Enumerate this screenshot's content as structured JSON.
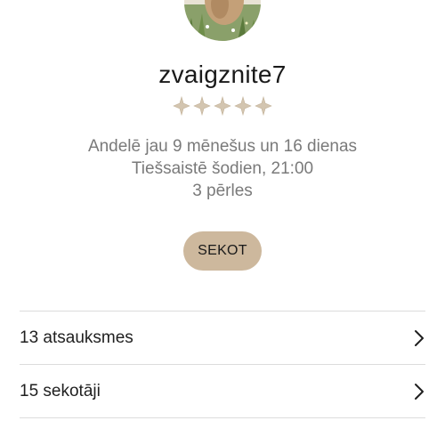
{
  "profile": {
    "username": "zvaigznite7",
    "rating": {
      "value": 0,
      "max": 5
    },
    "info": [
      "Andelē jau 9 mēnešus un 16 dienas",
      "Tiešsaistē šodien, 21:00",
      "3 pērles"
    ],
    "follow_label": "SEKOT"
  },
  "links": [
    {
      "label": "13 atsauksmes",
      "icon": "chevron-right-icon"
    },
    {
      "label": "15 sekotāji",
      "icon": "chevron-right-icon"
    }
  ],
  "colors": {
    "accent": "#cdb89d",
    "star_empty": "#d3c5b0",
    "muted_text": "#7a7a7a",
    "divider": "#dcdcdc"
  }
}
